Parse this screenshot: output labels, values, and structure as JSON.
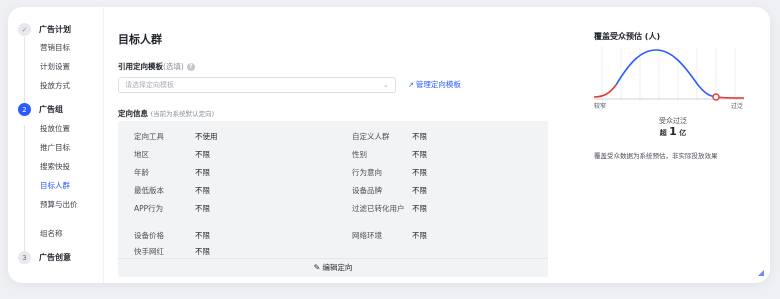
{
  "sidebar": {
    "steps": [
      {
        "num": "✓",
        "title": "广告计划",
        "items": [
          "营销目标",
          "计划设置",
          "投放方式"
        ]
      },
      {
        "num": "2",
        "title": "广告组",
        "items": [
          "投放位置",
          "推广目标",
          "搜索快投",
          "目标人群",
          "预算与出价",
          "组名称"
        ]
      },
      {
        "num": "3",
        "title": "广告创意",
        "items": []
      }
    ]
  },
  "main": {
    "title": "目标人群",
    "template_label": "引用定向模板",
    "template_label_optional": "(选填)",
    "template_placeholder": "请选择定向模板",
    "manage_link": "管理定向模板",
    "info_label": "定向信息",
    "info_hint": "(当前为系统默认定向)",
    "targeting": [
      {
        "name": "定向工具",
        "value": "不使用"
      },
      {
        "name": "自定义人群",
        "value": "不限"
      },
      {
        "name": "地区",
        "value": "不限"
      },
      {
        "name": "性别",
        "value": "不限"
      },
      {
        "name": "年龄",
        "value": "不限"
      },
      {
        "name": "行为意向",
        "value": "不限"
      },
      {
        "name": "最低版本",
        "value": "不限"
      },
      {
        "name": "设备品牌",
        "value": "不限"
      },
      {
        "name": "APP行为",
        "value": "不限"
      },
      {
        "name": "过滤已转化用户",
        "value": "不限"
      },
      {
        "name": "设备价格",
        "value": "不限"
      },
      {
        "name": "网络环境",
        "value": "不限"
      },
      {
        "name": "快手网红",
        "value": "不限"
      }
    ],
    "edit_label": "编辑定向"
  },
  "estimate": {
    "title": "覆盖受众预估 (人)",
    "axis_left": "较窄",
    "axis_right": "过泛",
    "audience_label": "受众过泛",
    "audience_prefix": "超",
    "audience_number": "1",
    "audience_unit": "亿",
    "note": "覆盖受众数据为系统预估，非实际投放效果"
  },
  "colors": {
    "accent": "#2b5bff",
    "curve_blue": "#2b5bff",
    "curve_red": "#e53935",
    "panel_bg": "#f2f3f5"
  }
}
